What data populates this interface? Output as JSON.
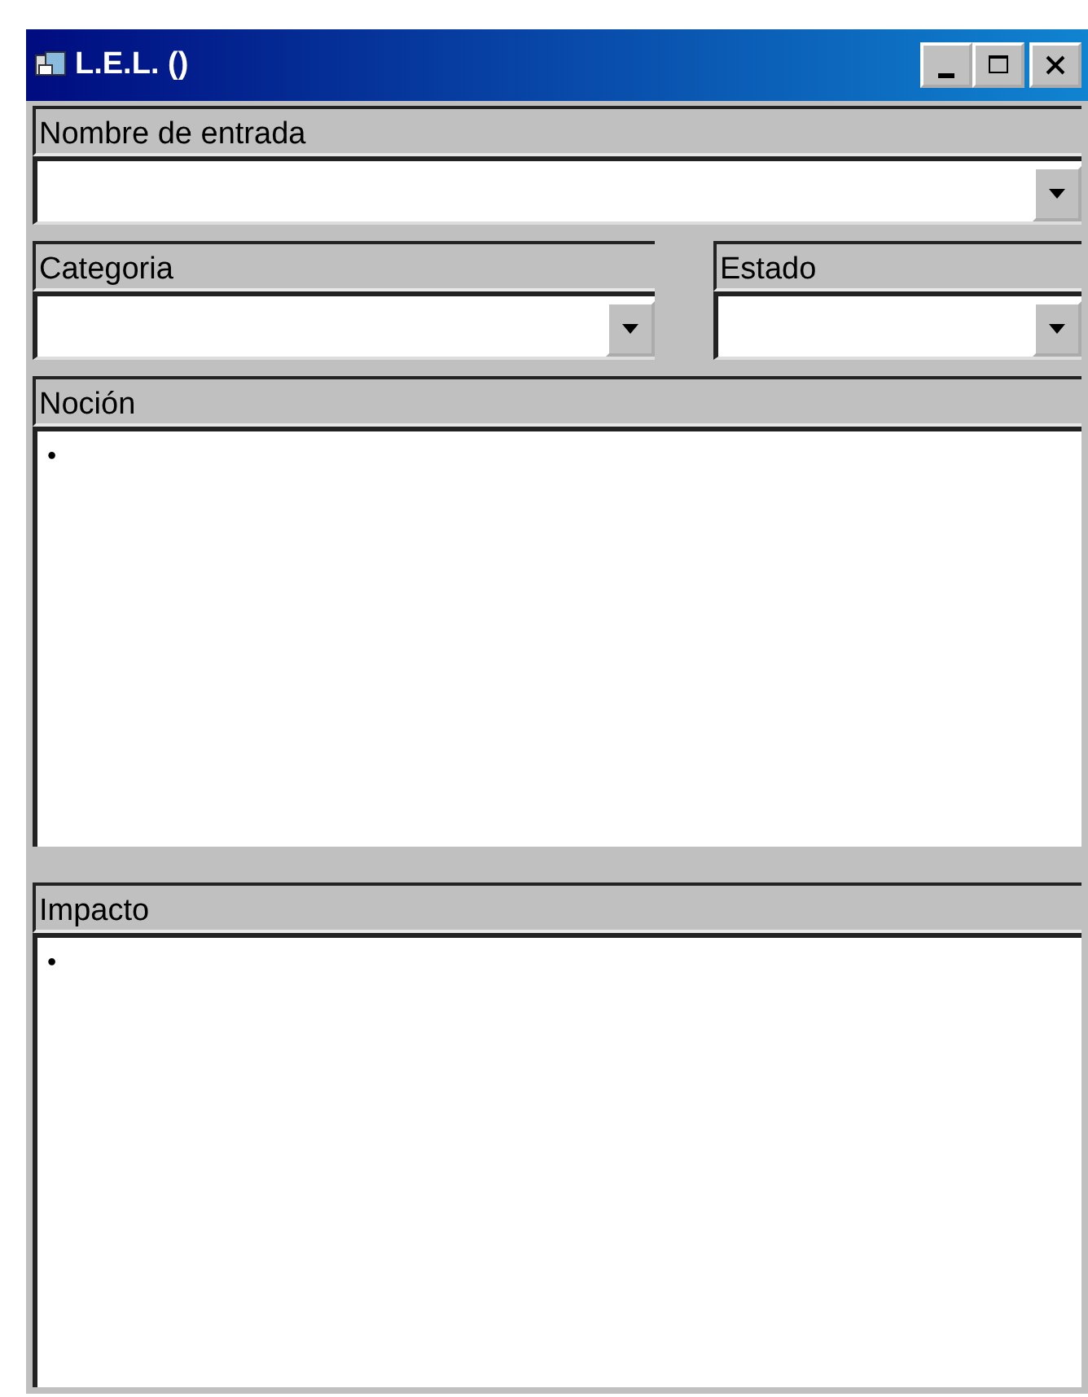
{
  "window": {
    "title": "L.E.L. ()"
  },
  "entry_name": {
    "label": "Nombre de entrada"
  },
  "category": {
    "label": "Categoria"
  },
  "state": {
    "label": "Estado"
  },
  "notion": {
    "label": "Noción",
    "text": "•"
  },
  "impact": {
    "label": "Impacto",
    "text": "•"
  }
}
